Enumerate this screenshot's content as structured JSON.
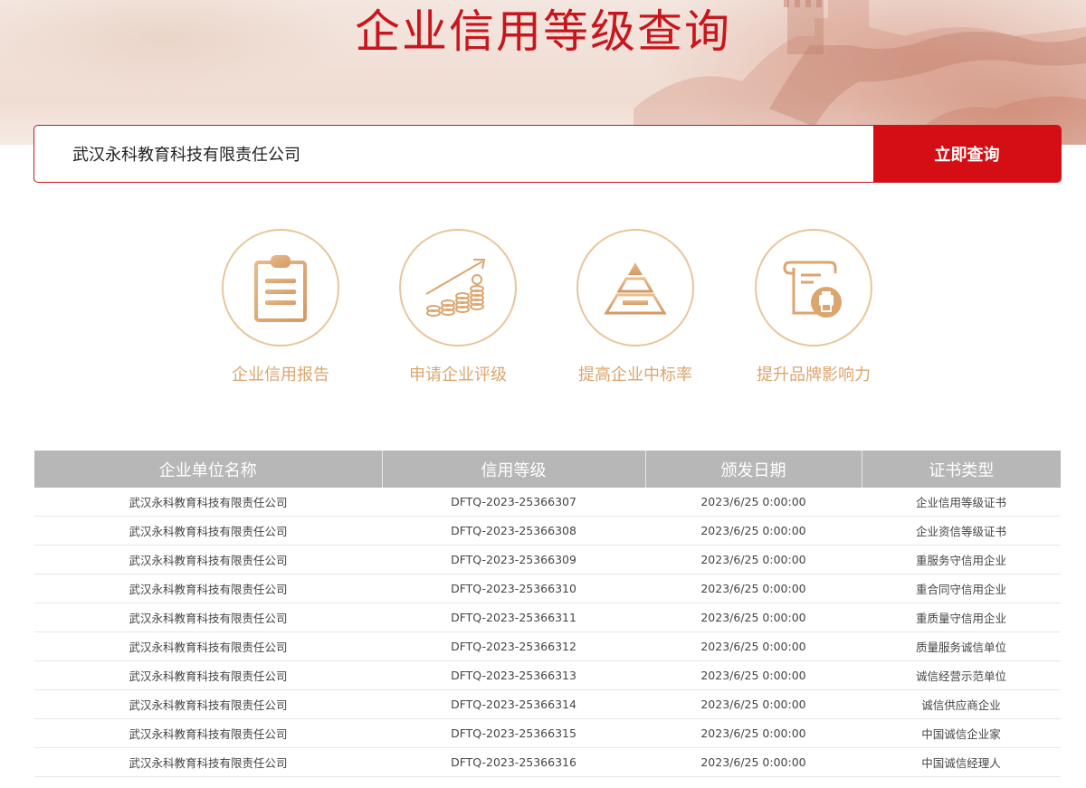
{
  "header": {
    "title": "企业信用等级查询"
  },
  "search": {
    "value": "武汉永科教育科技有限责任公司",
    "button_label": "立即查询"
  },
  "features": [
    {
      "label": "企业信用报告",
      "icon": "clipboard-icon"
    },
    {
      "label": "申请企业评级",
      "icon": "coin-growth-icon"
    },
    {
      "label": "提高企业中标率",
      "icon": "pyramid-icon"
    },
    {
      "label": "提升品牌影响力",
      "icon": "certificate-scroll-icon"
    }
  ],
  "colors": {
    "brand_red": "#d40e14",
    "title_red": "#c8161d",
    "gold": "#dba56e",
    "header_gray": "#b7b7b7"
  },
  "table": {
    "headers": [
      "企业单位名称",
      "信用等级",
      "颁发日期",
      "证书类型"
    ],
    "rows": [
      [
        "武汉永科教育科技有限责任公司",
        "DFTQ-2023-25366307",
        "2023/6/25 0:00:00",
        "企业信用等级证书"
      ],
      [
        "武汉永科教育科技有限责任公司",
        "DFTQ-2023-25366308",
        "2023/6/25 0:00:00",
        "企业资信等级证书"
      ],
      [
        "武汉永科教育科技有限责任公司",
        "DFTQ-2023-25366309",
        "2023/6/25 0:00:00",
        "重服务守信用企业"
      ],
      [
        "武汉永科教育科技有限责任公司",
        "DFTQ-2023-25366310",
        "2023/6/25 0:00:00",
        "重合同守信用企业"
      ],
      [
        "武汉永科教育科技有限责任公司",
        "DFTQ-2023-25366311",
        "2023/6/25 0:00:00",
        "重质量守信用企业"
      ],
      [
        "武汉永科教育科技有限责任公司",
        "DFTQ-2023-25366312",
        "2023/6/25 0:00:00",
        "质量服务诚信单位"
      ],
      [
        "武汉永科教育科技有限责任公司",
        "DFTQ-2023-25366313",
        "2023/6/25 0:00:00",
        "诚信经营示范单位"
      ],
      [
        "武汉永科教育科技有限责任公司",
        "DFTQ-2023-25366314",
        "2023/6/25 0:00:00",
        "诚信供应商企业"
      ],
      [
        "武汉永科教育科技有限责任公司",
        "DFTQ-2023-25366315",
        "2023/6/25 0:00:00",
        "中国诚信企业家"
      ],
      [
        "武汉永科教育科技有限责任公司",
        "DFTQ-2023-25366316",
        "2023/6/25 0:00:00",
        "中国诚信经理人"
      ]
    ]
  }
}
